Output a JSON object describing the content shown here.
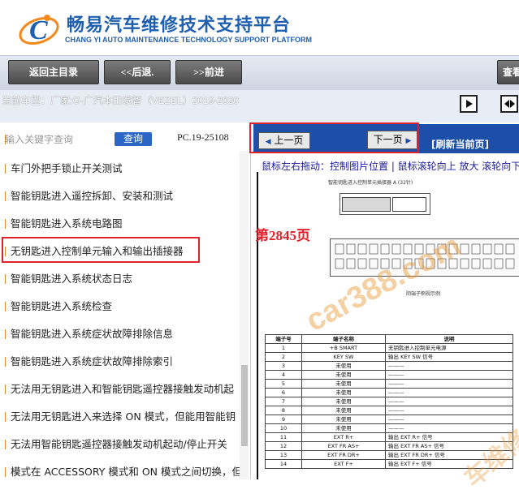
{
  "header": {
    "title": "畅易汽车维修技术支持平台",
    "subtitle": "CHANG YI AUTO MAINTENANCE TECHNOLOGY SUPPORT PLATFORM"
  },
  "nav": {
    "home": "返回主目录",
    "back": "<<后退.",
    "forward": ">>前进",
    "lookup": "查看"
  },
  "car": {
    "label": "当前车型：",
    "value": "厂家:G-广汽本田缤智（VEZEL）2019-2020"
  },
  "search": {
    "placeholder": "输入关键字查询",
    "button": "查询",
    "code": "PC.19-25108"
  },
  "doc_list": [
    "车门外把手锁止开关测试",
    "智能钥匙进入遥控拆卸、安装和测试",
    "智能钥匙进入系统电路图",
    "无钥匙进入控制单元输入和输出插接器",
    "智能钥匙进入系统状态日志",
    "智能钥匙进入系统检查",
    "智能钥匙进入系统症状故障排除信息",
    "智能钥匙进入系统症状故障排除索引",
    "无法用无钥匙进入和智能钥匙遥控器接触发动机起",
    "无法用无钥匙进入来选择 ON 模式，但能用智能钥",
    "无法用智能钥匙遥控器接触发动机起动/停止开关",
    "模式在 ACCESSORY 模式和 ON 模式之间切换，但"
  ],
  "viewer": {
    "prev": "上一页",
    "next": "下一页",
    "refresh": "[刷新当前页]",
    "hint": "鼠标左右拖动：控制图片位置 | 鼠标滚轮向上 放大  滚轮向下",
    "page_label": "第2845页",
    "diagram_caption": "智能钥匙进入控制单元插接器 A (32针)",
    "connector_caption": "阴端子侧视示例",
    "watermark": "car388.com",
    "watermark2": "车维修"
  },
  "pin_table": {
    "headers": [
      "端子号",
      "端子名称",
      "说明"
    ],
    "rows": [
      [
        "1",
        "+B SMART",
        "无钥匙进入控制单元电源"
      ],
      [
        "2",
        "KEY SW",
        "输出 KEY SW 信号"
      ],
      [
        "3",
        "未使用",
        "———"
      ],
      [
        "4",
        "未使用",
        "———"
      ],
      [
        "5",
        "未使用",
        "———"
      ],
      [
        "6",
        "未使用",
        "———"
      ],
      [
        "7",
        "未使用",
        "———"
      ],
      [
        "8",
        "未使用",
        "———"
      ],
      [
        "9",
        "未使用",
        "———"
      ],
      [
        "10",
        "未使用",
        "———"
      ],
      [
        "11",
        "EXT R+",
        "输出 EXT R+ 信号"
      ],
      [
        "12",
        "EXT FR AS+",
        "输出 EXT FR AS+ 信号"
      ],
      [
        "13",
        "EXT FR DR+",
        "输出 EXT FR DR+ 信号"
      ],
      [
        "14",
        "EXT F+",
        "输出 EXT F+ 信号"
      ]
    ]
  },
  "colors": {
    "accent_blue": "#1e4fa8",
    "highlight_red": "#e0202a",
    "nav_button": "#5a5a5a"
  }
}
